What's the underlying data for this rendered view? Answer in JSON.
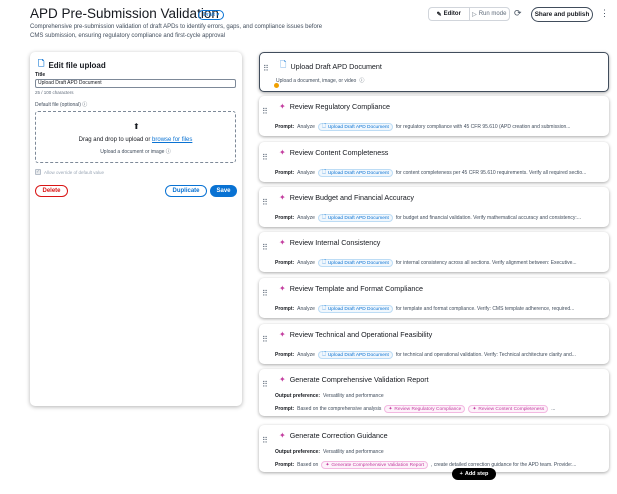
{
  "header": {
    "title": "APD Pre-Submission Validation",
    "status": "Draft",
    "status_caret": "▾",
    "subtitle": "Comprehensive pre-submission validation of draft APDs to identify errors, gaps, and compliance issues before CMS submission, ensuring regulatory compliance and first-cycle approval",
    "editor_label": "Editor",
    "run_label": "Run mode",
    "share_label": "Share and publish"
  },
  "editor": {
    "title": "Edit file upload",
    "title_label": "Title",
    "title_value": "Upload Draft APD Document",
    "char_count": "25 / 100 characters",
    "default_file_label": "Default file (optional)",
    "drop_text": "Drag and drop to upload or",
    "browse_text": "browse for files",
    "drop_hint": "Upload a document or image",
    "override_label": "Allow override of default value",
    "delete_label": "Delete",
    "duplicate_label": "Duplicate",
    "save_label": "Save"
  },
  "cards": [
    {
      "title": "Upload Draft APD Document",
      "icon": "file-icon",
      "desc": "Upload a document, image, or video"
    },
    {
      "title": "Review Regulatory Compliance",
      "icon": "ai-sparkle-icon",
      "label": "Prompt:",
      "pre": "Analyze",
      "token": "Upload Draft APD Document",
      "post": "for regulatory compliance with 45 CFR 95.610 (APD creation and submission..."
    },
    {
      "title": "Review Content Completeness",
      "icon": "ai-sparkle-icon",
      "label": "Prompt:",
      "pre": "Analyze",
      "token": "Upload Draft APD Document",
      "post": "for content completeness per 45 CFR 95.610 requirements. Verify all required sectio..."
    },
    {
      "title": "Review Budget and Financial Accuracy",
      "icon": "ai-sparkle-icon",
      "label": "Prompt:",
      "pre": "Analyze",
      "token": "Upload Draft APD Document",
      "post": "for budget and financial validation. Verify mathematical accuracy and consistency:..."
    },
    {
      "title": "Review Internal Consistency",
      "icon": "ai-sparkle-icon",
      "label": "Prompt:",
      "pre": "Analyze",
      "token": "Upload Draft APD Document",
      "post": "for internal consistency across all sections. Verify alignment between: Executive..."
    },
    {
      "title": "Review Template and Format Compliance",
      "icon": "ai-sparkle-icon",
      "label": "Prompt:",
      "pre": "Analyze",
      "token": "Upload Draft APD Document",
      "post": "for template and format compliance. Verify: CMS template adherence, required..."
    },
    {
      "title": "Review Technical and Operational Feasibility",
      "icon": "ai-sparkle-icon",
      "label": "Prompt:",
      "pre": "Analyze",
      "token": "Upload Draft APD Document",
      "post": "for technical and operational validation. Verify: Technical architecture clarity and..."
    },
    {
      "title": "Generate Comprehensive Validation Report",
      "icon": "ai-sparkle-icon",
      "pref_label": "Output preference:",
      "pref": "Versatility and performance",
      "label": "Prompt:",
      "pre": "Based on the comprehensive analysis",
      "token": "Review Regulatory Compliance",
      "token2": "Review Content Completeness",
      "post": "..."
    },
    {
      "title": "Generate Correction Guidance",
      "icon": "ai-sparkle-icon",
      "pref_label": "Output preference:",
      "pref": "Versatility and performance",
      "label": "Prompt:",
      "pre": "Based on",
      "token": "Generate Comprehensive Validation Report",
      "post": ", create detailed correction guidance for the APD team. Provide:..."
    }
  ],
  "add_step_label": "Add step"
}
